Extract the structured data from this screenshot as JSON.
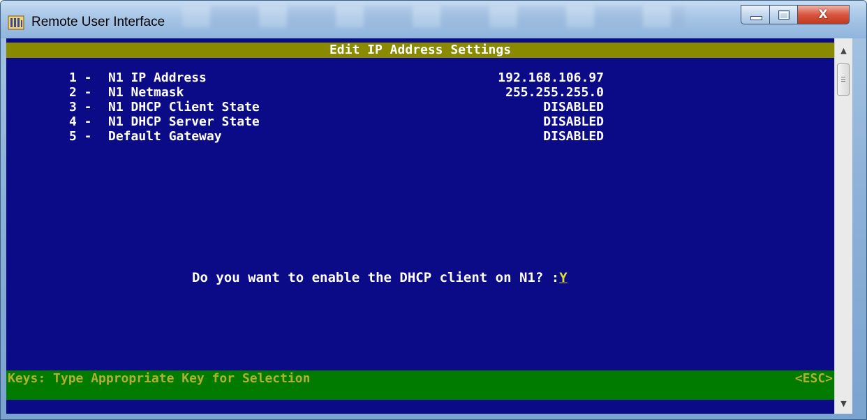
{
  "window": {
    "title": "Remote User Interface",
    "app_icon": "building-icon",
    "controls": {
      "minimize": "minimize-icon",
      "maximize": "maximize-icon",
      "close_glyph": "X"
    }
  },
  "terminal": {
    "header": "Edit IP Address Settings",
    "settings": [
      {
        "key": "1",
        "label": "N1 IP Address",
        "value": "192.168.106.97"
      },
      {
        "key": "2",
        "label": "N1 Netmask",
        "value": "255.255.255.0"
      },
      {
        "key": "3",
        "label": "N1 DHCP Client State",
        "value": "DISABLED"
      },
      {
        "key": "4",
        "label": "N1 DHCP Server State",
        "value": "DISABLED"
      },
      {
        "key": "5",
        "label": "Default Gateway",
        "value": "DISABLED"
      }
    ],
    "prompt": "Do you want to enable the DHCP client on N1? :",
    "prompt_answer": "Y",
    "footer_keys": "Keys: Type Appropriate Key for Selection",
    "footer_esc": "<ESC>"
  },
  "colors": {
    "terminal_bg": "#0b0b87",
    "header_bar": "#8a8a00",
    "footer_bar": "#007b00",
    "footer_text": "#b0b030",
    "text": "#ffffff"
  }
}
